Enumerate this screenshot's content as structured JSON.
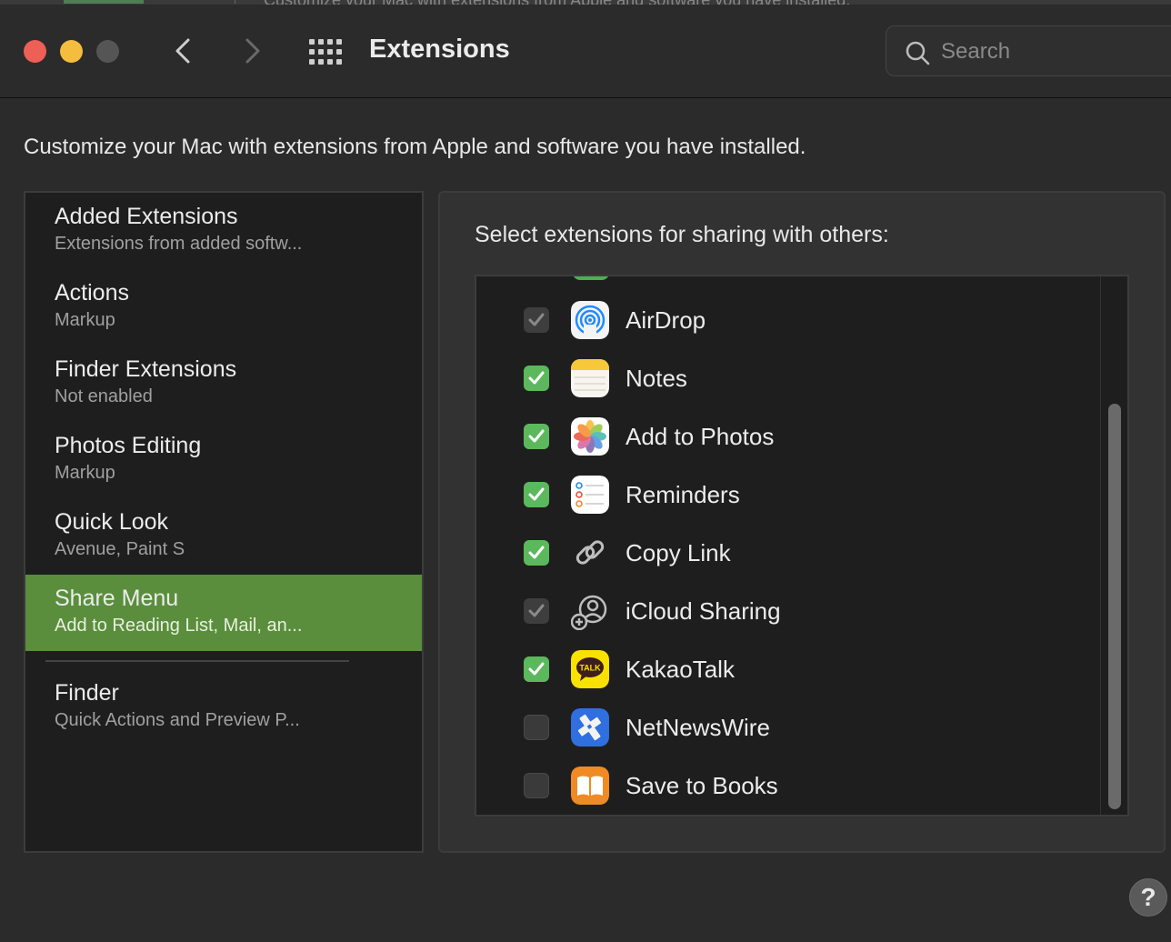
{
  "window": {
    "title": "Extensions",
    "behind_text": "Customize your Mac with extensions from Apple and software you have installed."
  },
  "search": {
    "placeholder": "Search"
  },
  "description": "Customize your Mac with extensions from Apple and software you have installed.",
  "sidebar": {
    "items": [
      {
        "title": "Added Extensions",
        "subtitle": "Extensions from added softw...",
        "selected": false
      },
      {
        "title": "Actions",
        "subtitle": "Markup",
        "selected": false
      },
      {
        "title": "Finder Extensions",
        "subtitle": "Not enabled",
        "selected": false
      },
      {
        "title": "Photos Editing",
        "subtitle": "Markup",
        "selected": false
      },
      {
        "title": "Quick Look",
        "subtitle": "Avenue, Paint S",
        "selected": false
      },
      {
        "title": "Share Menu",
        "subtitle": "Add to Reading List, Mail, an...",
        "selected": true
      },
      {
        "title": "Finder",
        "subtitle": "Quick Actions and Preview P...",
        "selected": false
      }
    ]
  },
  "panel": {
    "heading": "Select extensions for sharing with others:",
    "extensions": [
      {
        "label": "AirDrop",
        "state": "checked-disabled",
        "icon": "airdrop-icon"
      },
      {
        "label": "Notes",
        "state": "checked",
        "icon": "notes-icon"
      },
      {
        "label": "Add to Photos",
        "state": "checked",
        "icon": "photos-icon"
      },
      {
        "label": "Reminders",
        "state": "checked",
        "icon": "reminders-icon"
      },
      {
        "label": "Copy Link",
        "state": "checked",
        "icon": "link-icon"
      },
      {
        "label": "iCloud Sharing",
        "state": "checked-disabled",
        "icon": "icloud-sharing-icon"
      },
      {
        "label": "KakaoTalk",
        "state": "checked",
        "icon": "kakaotalk-icon"
      },
      {
        "label": "NetNewsWire",
        "state": "unchecked",
        "icon": "netnewswire-icon"
      },
      {
        "label": "Save to Books",
        "state": "unchecked",
        "icon": "books-icon"
      }
    ],
    "kakaotalk_icon_text": "TALK"
  },
  "help": {
    "label": "?"
  },
  "colors": {
    "accent_selected": "#5a8e3c",
    "checkbox_on": "#5cb85c",
    "close": "#ee5f57",
    "minimize": "#f5bd3d"
  }
}
